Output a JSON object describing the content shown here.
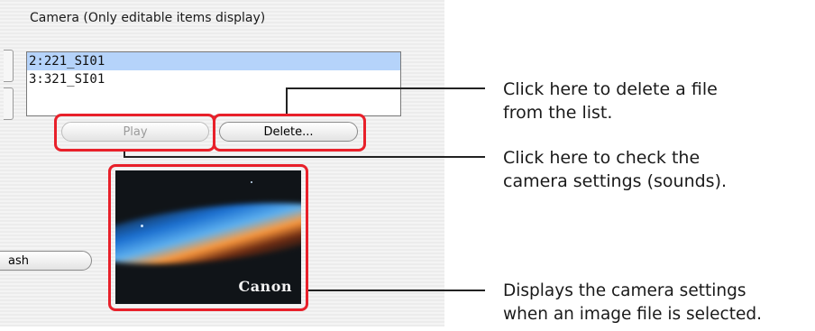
{
  "panel": {
    "title": "Camera (Only editable items display)",
    "list_items": [
      {
        "label": "2:221_SI01",
        "selected": true
      },
      {
        "label": "3:321_SI01",
        "selected": false
      }
    ],
    "play_label": "Play",
    "delete_label": "Delete...",
    "partial_button_label": "ash",
    "preview_brand": "Canon"
  },
  "annotations": {
    "delete": {
      "line1": "Click here to delete a file",
      "line2": "from the list."
    },
    "play": {
      "line1": "Click here to check the",
      "line2": "camera settings (sounds)."
    },
    "preview": {
      "line1": "Displays the camera settings",
      "line2": "when an image file is selected."
    }
  },
  "colors": {
    "callout": "#e8202a",
    "selection": "#b5d3fa",
    "panel_background": "#ececec"
  }
}
